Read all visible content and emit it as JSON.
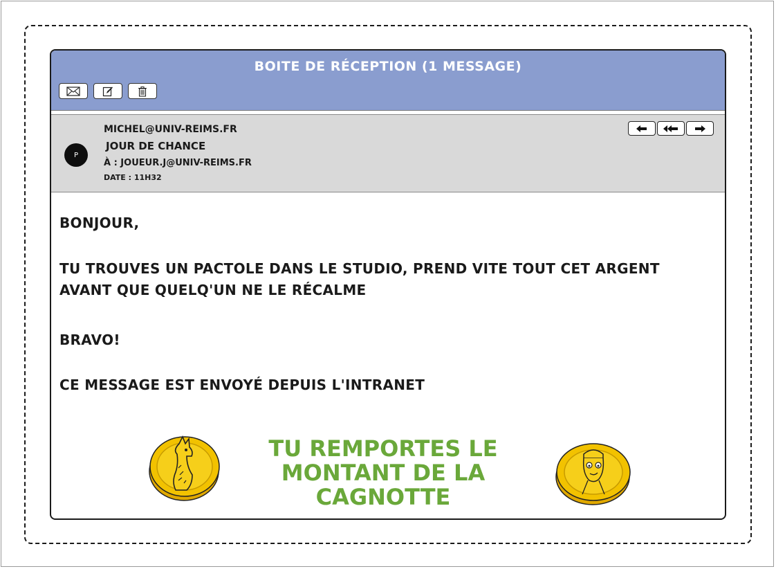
{
  "window": {
    "title": "Boite de réception (1 message)"
  },
  "toolbar": {
    "buttons": [
      {
        "icon": "envelope-icon"
      },
      {
        "icon": "compose-icon"
      },
      {
        "icon": "trash-icon"
      }
    ]
  },
  "email": {
    "avatar_letter": "P",
    "from": "michel@univ-reims.fr",
    "subject": "Jour de chance",
    "to": "À : joueur.j@univ-reims.fr",
    "date": "Date : 11h32",
    "actions": [
      {
        "icon": "reply-icon"
      },
      {
        "icon": "reply-all-icon"
      },
      {
        "icon": "forward-icon"
      }
    ],
    "body": {
      "greeting": "Bonjour,",
      "line1": "Tu trouves un pactole dans le studio, prend vite tout cet argent",
      "line2": "avant que quelq'un ne le récalme",
      "cheer": "Bravo!",
      "footer": "Ce message est envoyé depuis l'intranet"
    }
  },
  "banner": {
    "line1": "Tu remportes le",
    "line2": "montant de la cagnotte"
  },
  "colors": {
    "titlebar": "#8a9dcf",
    "header_bg": "#d9d9d9",
    "banner_text": "#6aa83a",
    "coin_gold": "#f2c200"
  },
  "icons": {
    "left_coin": "llama-coin-icon",
    "right_coin": "player-face-coin-icon"
  }
}
